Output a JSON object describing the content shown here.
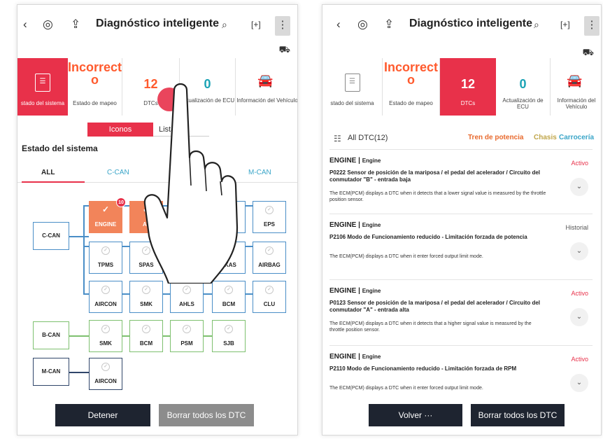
{
  "left": {
    "title": "Diagnóstico inteligente",
    "tabs": [
      {
        "value": "Incorrect\no",
        "label": "Estado de mapeo"
      },
      {
        "value": "12",
        "label": "DTCs"
      },
      {
        "value": "0",
        "label": "Actualización de ECU"
      },
      {
        "label": "Información del Vehículo"
      }
    ],
    "active_tab_label": "stado del sistema",
    "view_toggle": {
      "icons": "Iconos",
      "list": "Lista"
    },
    "section_title": "Estado del sistema",
    "subtabs": [
      "ALL",
      "C-CAN",
      "M-CAN"
    ],
    "buses": [
      "C-CAN",
      "B-CAN",
      "M-CAN"
    ],
    "ccan_row1": [
      "ENGINE",
      "AT",
      "ESP",
      "EPS"
    ],
    "ccan_row2": [
      "TPMS",
      "SPAS",
      "LKAS",
      "AIRBAG"
    ],
    "ccan_row3": [
      "AIRCON",
      "SMK",
      "AHLS",
      "BCM",
      "CLU"
    ],
    "bcan_row": [
      "SMK",
      "BCM",
      "PSM",
      "SJB"
    ],
    "mcan_row": [
      "AIRCON"
    ],
    "engine_badge": "10",
    "btn_stop": "Detener",
    "btn_clear": "Borrar todos los DTC"
  },
  "right": {
    "title": "Diagnóstico inteligente",
    "tabs": [
      {
        "label": "stado del sistema"
      },
      {
        "value": "Incorrect\no",
        "label": "Estado de mapeo"
      },
      {
        "value": "12",
        "label": "DTCs"
      },
      {
        "value": "0",
        "label": "Actualización de ECU"
      },
      {
        "label": "Información del Vehículo"
      }
    ],
    "filter": {
      "all": "All DTC(12)",
      "f1": "Tren de potencia",
      "f2": "Chasis",
      "f3": "Carrocería"
    },
    "dtcs": [
      {
        "sys": "ENGINE",
        "sub": "Engine",
        "state": "Activo",
        "desc": "P0222 Sensor de posición de la mariposa / el pedal del acelerador / Circuito del conmutador \"B\" - entrada baja",
        "expl": "The ECM(PCM) displays a DTC when it detects that a lower signal value is measured by the throttle position sensor."
      },
      {
        "sys": "ENGINE",
        "sub": "Engine",
        "state": "Historial",
        "desc": "P2106 Modo de Funcionamiento reducido - Limitación forzada de potencia",
        "expl": "The ECM(PCM) displays a DTC when it enter forced output limit mode."
      },
      {
        "sys": "ENGINE",
        "sub": "Engine",
        "state": "Activo",
        "desc": "P0123 Sensor de posición de la mariposa / el pedal del acelerador / Circuito del conmutador \"A\" - entrada alta",
        "expl": "The ECM(PCM) displays a DTC when it detects that a higher signal value is measured by the throttle position sensor."
      },
      {
        "sys": "ENGINE",
        "sub": "Engine",
        "state": "Activo",
        "desc": "P2110 Modo de Funcionamiento reducido - Limitación forzada de RPM",
        "expl": "The ECM(PCM) displays a DTC when it enter forced output limit mode."
      }
    ],
    "btn_back": "Volver ···",
    "btn_clear": "Borrar todos los DTC"
  },
  "colors": {
    "accent": "#e8314a",
    "error": "#f2845a",
    "ccan": "#4a8ec7",
    "bcan": "#7ec06f",
    "mcan": "#30466a"
  }
}
